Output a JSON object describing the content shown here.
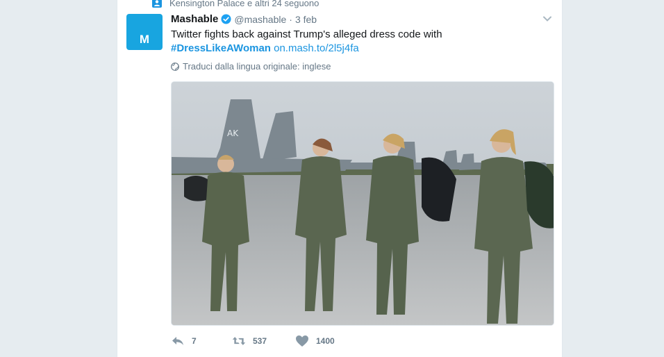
{
  "context_line": {
    "text": "Kensington Palace e altri 24 seguono",
    "icon": "person-follow-icon"
  },
  "tweet": {
    "avatar_letter": "M",
    "name": "Mashable",
    "handle": "@mashable",
    "separator": "·",
    "date": "3 feb",
    "text_prefix": "Twitter fights back against Trump's alleged dress code with",
    "hashtag": "#DressLikeAWoman",
    "link": "on.mash.to/2l5j4fa",
    "translate": "Traduci dalla lingua originale: inglese",
    "media_alt": "Four female pilots in flight suits walking on an airfield with fighter jets behind them"
  },
  "actions": {
    "reply_count": "7",
    "retweet_count": "537",
    "like_count": "1400"
  },
  "colors": {
    "accent": "#1b95e0",
    "avatar_bg": "#18a5e0",
    "muted": "#657786",
    "text": "#14171a"
  }
}
